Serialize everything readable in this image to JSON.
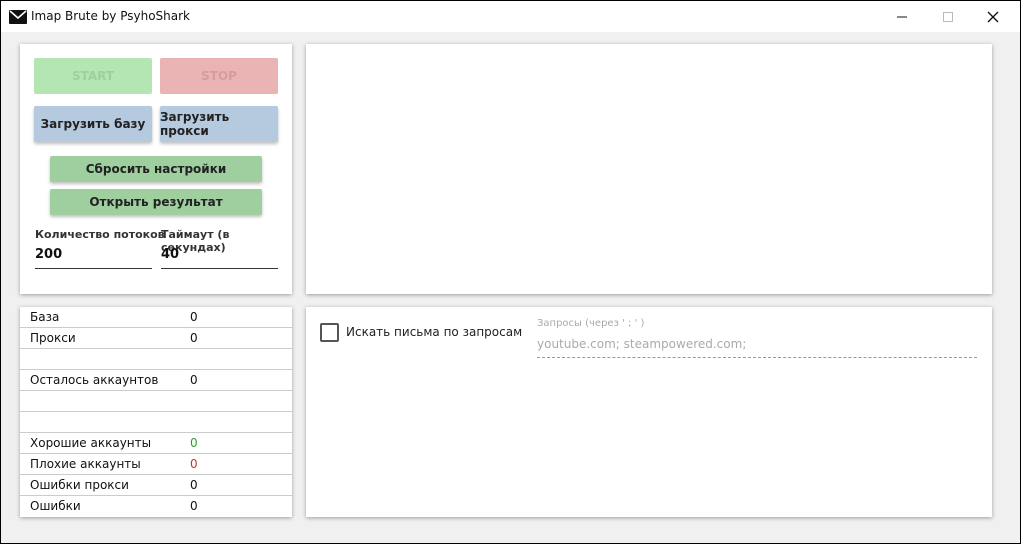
{
  "window": {
    "title": "Imap Brute by PsyhoShark",
    "minimize_glyph": "—",
    "maximize_glyph": "☐",
    "close_glyph": "✕"
  },
  "controls": {
    "start_label": "START",
    "stop_label": "STOP",
    "load_base_label": "Загрузить базу",
    "load_proxy_label": "Загрузить прокси",
    "reset_label": "Сбросить настройки",
    "open_result_label": "Открыть результат",
    "threads_label": "Количество потоков",
    "threads_value": "200",
    "timeout_label": "Таймаут (в секундах)",
    "timeout_value": "40"
  },
  "stats": {
    "base_label": "База",
    "base_value": "0",
    "proxy_label": "Прокси",
    "proxy_value": "0",
    "remaining_label": "Осталось аккаунтов",
    "remaining_value": "0",
    "good_label": "Хорошие аккаунты",
    "good_value": "0",
    "bad_label": "Плохие аккаунты",
    "bad_value": "0",
    "proxy_errors_label": "Ошибки прокси",
    "proxy_errors_value": "0",
    "errors_label": "Ошибки",
    "errors_value": "0"
  },
  "search": {
    "checkbox_label": "Искать письма по запросам",
    "checked": false,
    "query_label": "Запросы (через ' ; ' )",
    "query_placeholder": "youtube.com; steampowered.com;"
  },
  "colors": {
    "good": "#2e9e2e",
    "bad": "#d03030",
    "start_bg": "#b3e6b3",
    "stop_bg": "#eab4b4",
    "load_bg": "#b6cadf",
    "action_bg": "#9fce9f"
  }
}
